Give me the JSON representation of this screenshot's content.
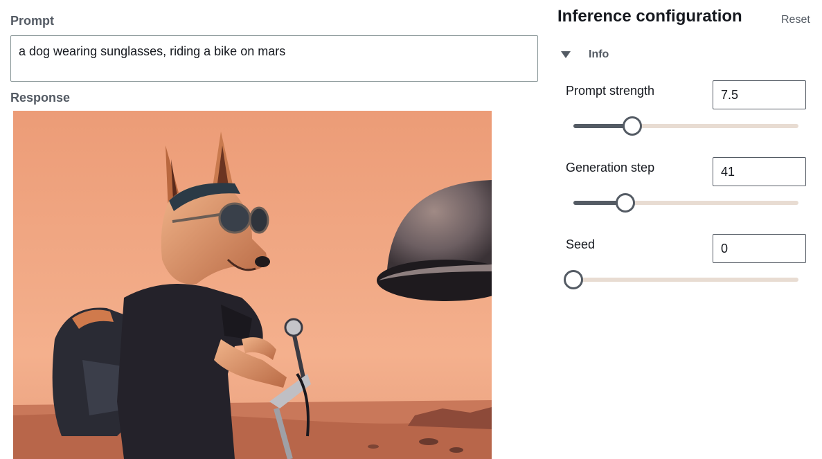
{
  "prompt": {
    "label": "Prompt",
    "value": "a dog wearing sunglasses, riding a bike on mars"
  },
  "response": {
    "label": "Response",
    "image_description_icon": "generated-image"
  },
  "config": {
    "title": "Inference configuration",
    "reset_label": "Reset",
    "info_label": "Info",
    "params": [
      {
        "label": "Prompt strength",
        "value": "7.5",
        "slider_fraction": 0.26
      },
      {
        "label": "Generation step",
        "value": "41",
        "slider_fraction": 0.23
      },
      {
        "label": "Seed",
        "value": "0",
        "slider_fraction": 0.0
      }
    ]
  },
  "colors": {
    "sky": "#ef9f79",
    "slider_track": "#e8dcd2",
    "slider_fill": "#545b64"
  }
}
